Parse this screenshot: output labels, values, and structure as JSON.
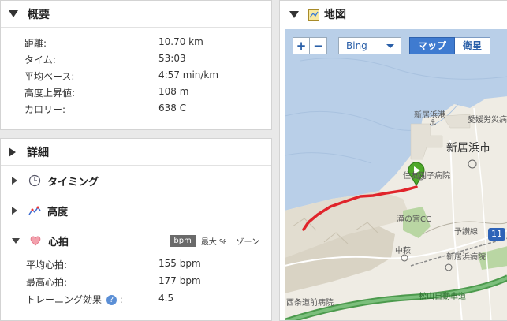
{
  "summary": {
    "title": "概要",
    "rows": [
      {
        "label": "距離:",
        "value": "10.70 km"
      },
      {
        "label": "タイム:",
        "value": "53:03"
      },
      {
        "label": "平均ペース:",
        "value": "4:57 min/km"
      },
      {
        "label": "高度上昇値:",
        "value": "108 m"
      },
      {
        "label": "カロリー:",
        "value": "638 C"
      }
    ]
  },
  "detail": {
    "title": "詳細",
    "timing": "タイミング",
    "elevation": "高度",
    "heart_rate": {
      "title": "心拍",
      "tabs": [
        "bpm",
        "最大 %",
        "ゾーン"
      ],
      "active_tab": "bpm",
      "rows": [
        {
          "label": "平均心拍:",
          "value": "155 bpm"
        },
        {
          "label": "最高心拍:",
          "value": "177 bpm"
        },
        {
          "label": "トレーニング効果",
          "value": "4.5"
        }
      ]
    }
  },
  "map": {
    "title": "地図",
    "zoom_in": "+",
    "zoom_out": "−",
    "provider": "Bing",
    "type_map": "マップ",
    "type_satellite": "衛星",
    "labels": {
      "port": "新居浜港",
      "ehime": "愛媛労災病",
      "city": "新居浜市",
      "hospital": "住友別子病院",
      "takinomiya": "滝の宮CC",
      "yosan": "予讃線",
      "nakahagi": "中萩",
      "niihama_hosp": "新居浜病院",
      "nishijo": "西条道前病院",
      "expressway": "松山自動車道",
      "shield": "11"
    }
  },
  "colors": {
    "route": "#e0242b",
    "marker": "#4ea82a",
    "sea": "#b9cfe8",
    "land": "#efece4"
  }
}
